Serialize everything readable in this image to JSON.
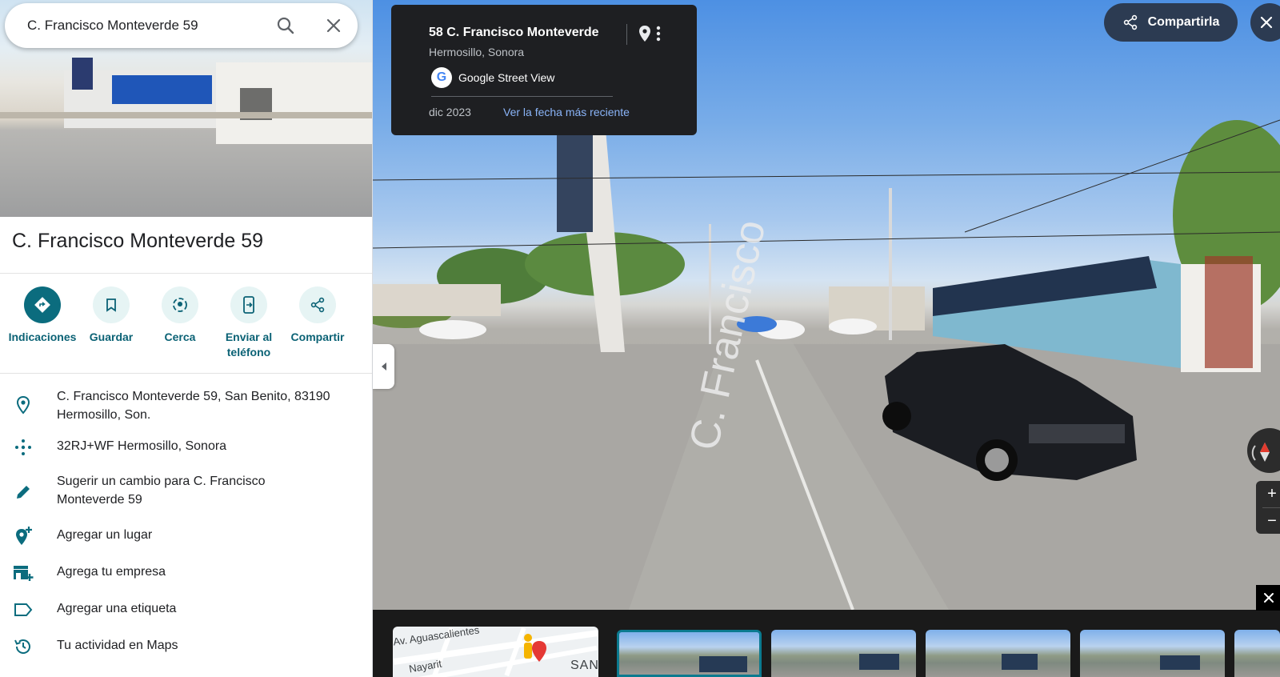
{
  "search": {
    "query": "C. Francisco Monteverde 59"
  },
  "place": {
    "title": "C. Francisco Monteverde 59"
  },
  "actions": [
    {
      "label": "Indicaciones",
      "icon": "directions-icon"
    },
    {
      "label": "Guardar",
      "icon": "bookmark-icon"
    },
    {
      "label": "Cerca",
      "icon": "nearby-icon"
    },
    {
      "label": "Enviar al teléfono",
      "icon": "send-to-phone-icon"
    },
    {
      "label": "Compartir",
      "icon": "share-icon"
    }
  ],
  "info": {
    "address": "C. Francisco Monteverde 59, San Benito, 83190 Hermosillo, Son.",
    "plus_code": "32RJ+WF Hermosillo, Sonora",
    "suggest": "Sugerir un cambio para C. Francisco Monteverde 59",
    "add_place": "Agregar un lugar",
    "add_business": "Agrega tu empresa",
    "add_label": "Agregar una etiqueta",
    "activity": "Tu actividad en Maps"
  },
  "streetview": {
    "title": "58 C. Francisco Monteverde",
    "subtitle": "Hermosillo, Sonora",
    "provider": "Google Street View",
    "date": "dic 2023",
    "latest_link": "Ver la fecha más reciente",
    "share_label": "Compartirla",
    "road_marking": "C. Francisco"
  },
  "minimap": {
    "street1": "Av. Aguascalientes",
    "street2": "Nayarit",
    "street3": "SAN"
  },
  "colors": {
    "accent": "#0b6c7e",
    "panel_dark": "#1e1f22",
    "share_bg": "#2c3b52",
    "link": "#8ab4f8"
  }
}
